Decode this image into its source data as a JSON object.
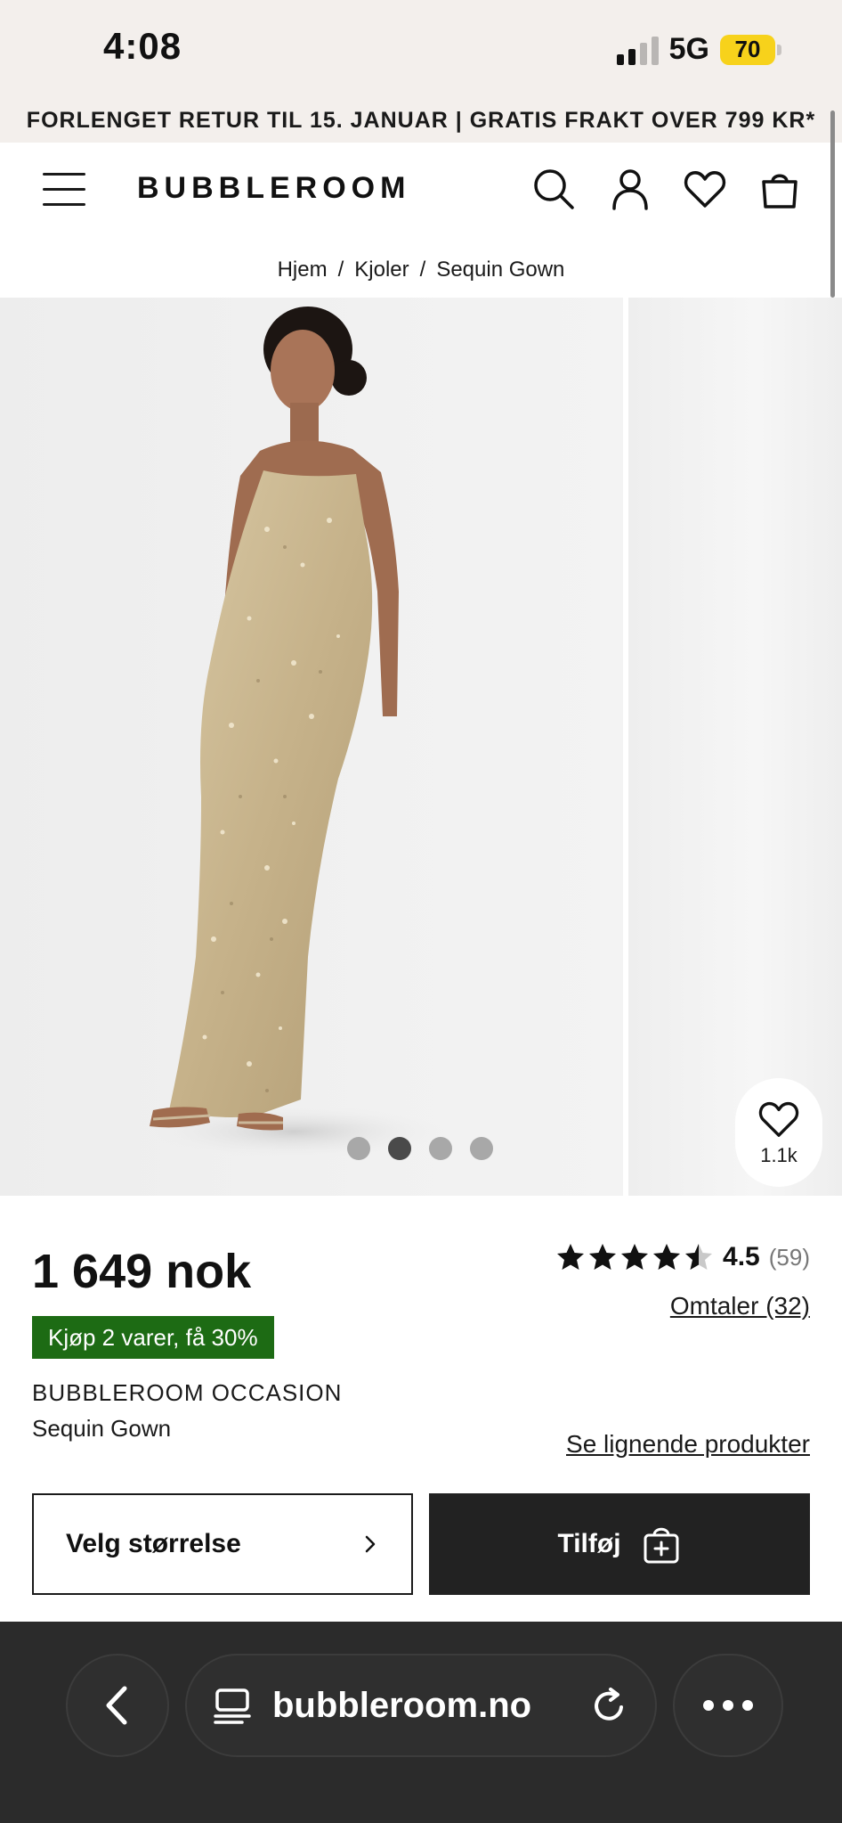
{
  "status_bar": {
    "time": "4:08",
    "network": "5G",
    "battery": "70"
  },
  "promo_banner": "FORLENGET RETUR TIL 15. JANUAR | GRATIS FRAKT OVER 799 KR*",
  "header": {
    "logo": "BUBBLEROOM"
  },
  "breadcrumb": {
    "items": [
      "Hjem",
      "Kjoler",
      "Sequin Gown"
    ],
    "separator": "/"
  },
  "gallery": {
    "slides": 4,
    "active_slide": 2,
    "favorites_count": "1.1k"
  },
  "product": {
    "price": "1 649 nok",
    "rating": "4.5",
    "rating_count": "(59)",
    "rating_stars": 4.5,
    "reviews_link": "Omtaler (32)",
    "promo_badge": "Kjøp 2 varer, få 30%",
    "brand": "BUBBLEROOM OCCASION",
    "name": "Sequin Gown",
    "similar_link": "Se lignende produkter"
  },
  "actions": {
    "size_label": "Velg størrelse",
    "add_label": "Tilføj"
  },
  "browser": {
    "url": "bubbleroom.no"
  },
  "colors": {
    "promo_green": "#1d6b14",
    "banner_bg": "#f3efec",
    "button_dark": "#222222",
    "battery_yellow": "#f7d21b"
  }
}
